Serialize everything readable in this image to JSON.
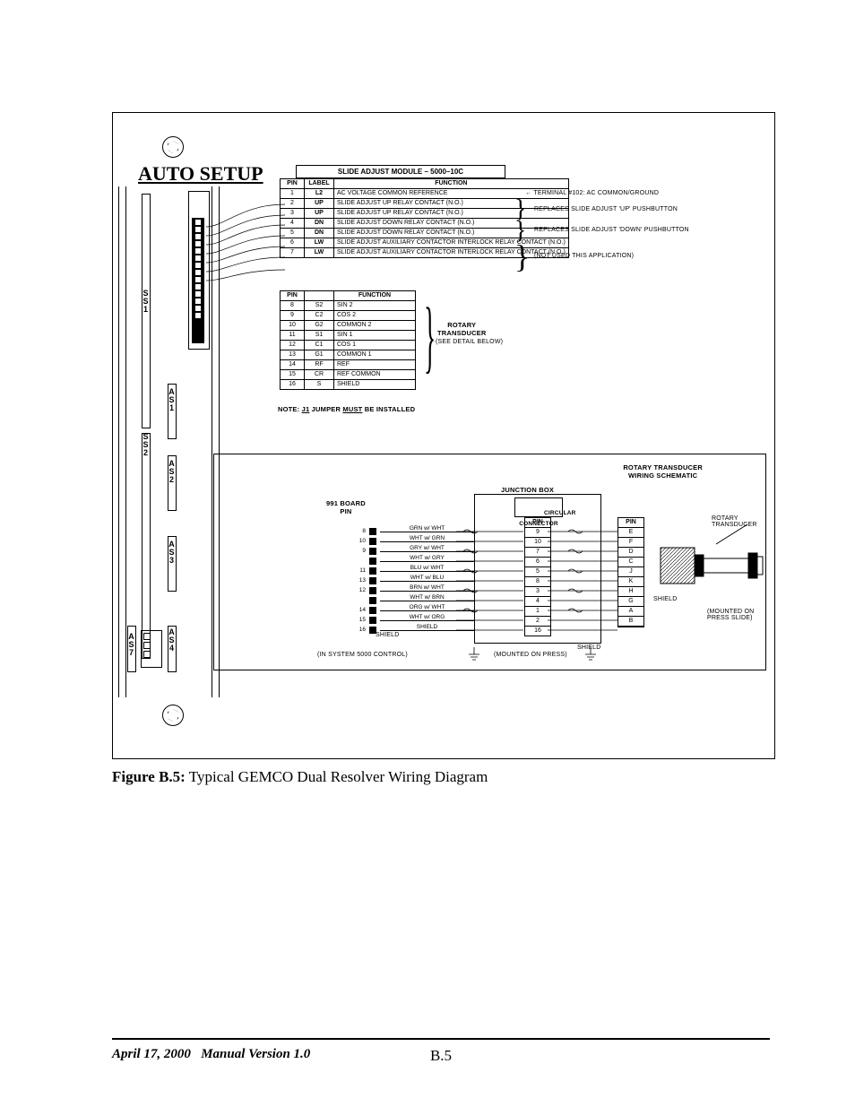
{
  "caption_label": "Figure B.5:",
  "caption_text": " Typical GEMCO Dual Resolver Wiring Diagram",
  "footer_date": "April 17, 2000",
  "footer_version": "Manual Version 1.0",
  "page_number": "B.5",
  "diagram": {
    "title_main": "AUTO  SETUP",
    "module_title": "SLIDE ADJUST MODULE  –  5000–10C",
    "table1_headers": [
      "PIN",
      "LABEL",
      "FUNCTION"
    ],
    "table1_rows": [
      {
        "pin": "1",
        "label": "L2",
        "func": "AC VOLTAGE COMMON REFERENCE"
      },
      {
        "pin": "2",
        "label": "UP",
        "func": "SLIDE ADJUST UP RELAY CONTACT (N.O.)"
      },
      {
        "pin": "3",
        "label": "UP",
        "func": "SLIDE ADJUST UP RELAY CONTACT (N.O.)"
      },
      {
        "pin": "4",
        "label": "DN",
        "func": "SLIDE ADJUST DOWN RELAY CONTACT (N.O.)"
      },
      {
        "pin": "5",
        "label": "DN",
        "func": "SLIDE ADJUST DOWN RELAY CONTACT (N.O.)"
      },
      {
        "pin": "6",
        "label": "LW",
        "func": "SLIDE ADJUST AUXILIARY CONTACTOR INTERLOCK RELAY CONTACT (N.O.)"
      },
      {
        "pin": "7",
        "label": "LW",
        "func": "SLIDE ADJUST AUXILIARY CONTACTOR INTERLOCK RELAY CONTACT (N.O.)"
      }
    ],
    "table2_headers": [
      "PIN",
      "",
      "FUNCTION"
    ],
    "table2_rows": [
      {
        "pin": "8",
        "label": "S2",
        "func": "SIN 2"
      },
      {
        "pin": "9",
        "label": "C2",
        "func": "COS 2"
      },
      {
        "pin": "10",
        "label": "G2",
        "func": "COMMON 2"
      },
      {
        "pin": "11",
        "label": "S1",
        "func": "SIN 1"
      },
      {
        "pin": "12",
        "label": "C1",
        "func": "COS 1"
      },
      {
        "pin": "13",
        "label": "G1",
        "func": "COMMON 1"
      },
      {
        "pin": "14",
        "label": "RF",
        "func": "REF"
      },
      {
        "pin": "15",
        "label": "CR",
        "func": "REF COMMON"
      },
      {
        "pin": "16",
        "label": "S",
        "func": "SHIELD"
      }
    ],
    "note_jumper": "NOTE: J1 JUMPER MUST BE INSTALLED",
    "side_terminal_note": "TERMINAL #102:   AC COMMON/GROUND",
    "side_up_note": "REPLACES SLIDE ADJUST 'UP' PUSHBUTTON",
    "side_dn_note": "REPLACES SLIDE ADJUST 'DOWN' PUSHBUTTON",
    "side_notused_note": "(NOT USED THIS APPLICATION)",
    "rotary_label": "ROTARY\nTRANSDUCER",
    "rotary_sub": "(SEE DETAIL BELOW)",
    "lower_title": "ROTARY TRANSDUCER\nWIRING SCHEMATIC",
    "junction_box": "JUNCTION BOX",
    "circular_conn": "CIRCULAR\nCONNECTOR",
    "board_label": "991 BOARD\nPIN",
    "in_system": "(IN SYSTEM 5000 CONTROL)",
    "mounted_press": "(MOUNTED ON PRESS)",
    "mounted_slide": "(MOUNTED ON PRESS SLIDE)",
    "rotary_trans_label": "ROTARY TRANSDUCER",
    "shield": "SHIELD",
    "shield2": "SHIELD",
    "shield3": "SHIELD",
    "wire_rows": [
      {
        "pin": "8",
        "color": "GRN w/ WHT",
        "cpin": "9",
        "rpin": "E"
      },
      {
        "pin": "10",
        "color": "WHT w/ GRN",
        "cpin": "10",
        "rpin": "F"
      },
      {
        "pin": "9",
        "color": "GRY w/ WHT",
        "cpin": "7",
        "rpin": "D"
      },
      {
        "pin": "",
        "color": "WHT w/ GRY",
        "cpin": "6",
        "rpin": "C"
      },
      {
        "pin": "11",
        "color": "BLU w/ WHT",
        "cpin": "5",
        "rpin": "J"
      },
      {
        "pin": "13",
        "color": "WHT w/ BLU",
        "cpin": "8",
        "rpin": "K"
      },
      {
        "pin": "12",
        "color": "BRN w/ WHT",
        "cpin": "3",
        "rpin": "H"
      },
      {
        "pin": "",
        "color": "WHT w/ BRN",
        "cpin": "4",
        "rpin": "G"
      },
      {
        "pin": "14",
        "color": "ORG w/ WHT",
        "cpin": "1",
        "rpin": "A"
      },
      {
        "pin": "15",
        "color": "WHT w/ ORG",
        "cpin": "2",
        "rpin": "B"
      },
      {
        "pin": "16",
        "color": "SHIELD",
        "cpin": "16",
        "rpin": ""
      }
    ],
    "rack_labels": {
      "ss1": "S\nS\n1",
      "ss2": "S\nS\n2",
      "as1": "A\nS\n1",
      "as2": "A\nS\n2",
      "as3": "A\nS\n3",
      "as4": "A\nS\n4",
      "as7": "A\nS\n7"
    },
    "pin_hdr": "PIN"
  }
}
